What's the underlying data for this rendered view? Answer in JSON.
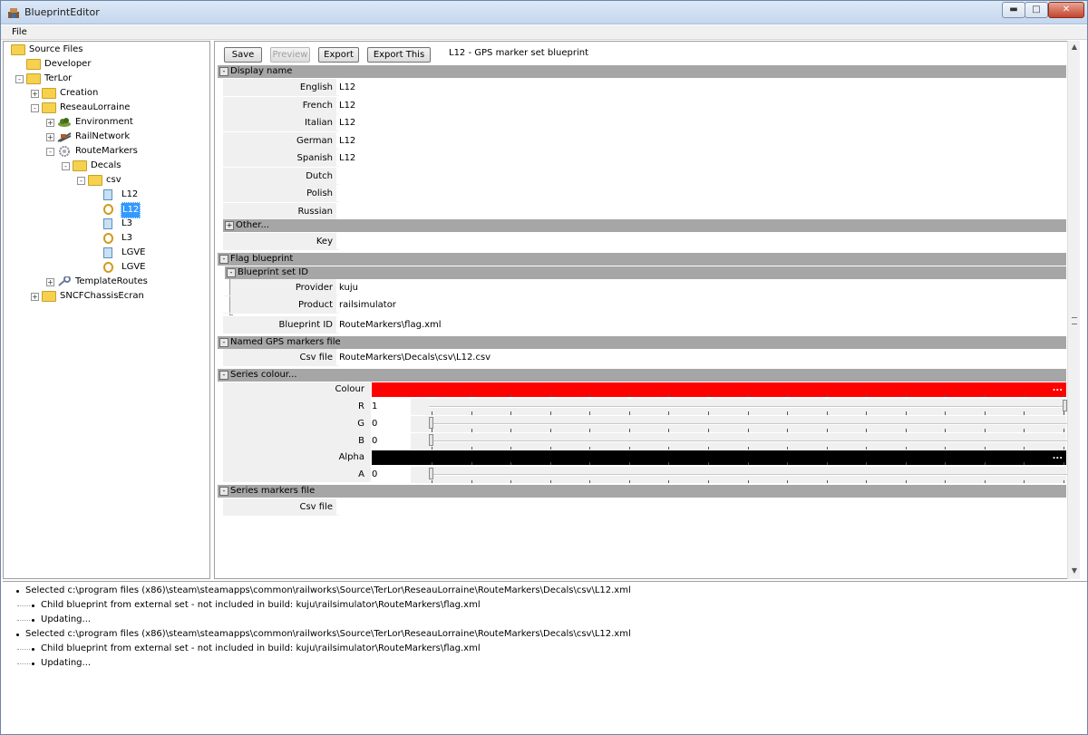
{
  "window": {
    "title": "BlueprintEditor",
    "min": "0",
    "max": "1",
    "close": "x"
  },
  "menu": {
    "file": "File"
  },
  "tree": [
    {
      "id": "source-files",
      "label": "Source Files",
      "icon": "folder-icon",
      "level": 0,
      "exp": ""
    },
    {
      "id": "developer",
      "label": "Developer",
      "icon": "folder-icon",
      "level": 1,
      "exp": ""
    },
    {
      "id": "terlor",
      "label": "TerLor",
      "icon": "folder-icon",
      "level": 1,
      "exp": "-"
    },
    {
      "id": "creation",
      "label": "Creation",
      "icon": "folder-icon",
      "level": 2,
      "exp": "+"
    },
    {
      "id": "reseaulorraine",
      "label": "ReseauLorraine",
      "icon": "folder-icon",
      "level": 2,
      "exp": "-"
    },
    {
      "id": "environment",
      "label": "Environment",
      "icon": "environment-icon",
      "level": 3,
      "exp": "+"
    },
    {
      "id": "railnetwork",
      "label": "RailNetwork",
      "icon": "rail-icon",
      "level": 3,
      "exp": "+"
    },
    {
      "id": "routemarkers",
      "label": "RouteMarkers",
      "icon": "gear-icon",
      "level": 3,
      "exp": "-"
    },
    {
      "id": "decals",
      "label": "Decals",
      "icon": "folder-icon",
      "level": 4,
      "exp": "-"
    },
    {
      "id": "csv",
      "label": "csv",
      "icon": "folder-icon",
      "level": 5,
      "exp": "-"
    },
    {
      "id": "l12-doc",
      "label": "L12",
      "icon": "document-icon",
      "level": 6,
      "exp": ""
    },
    {
      "id": "l12-gps",
      "label": "L12",
      "icon": "gps-marker-icon",
      "level": 6,
      "exp": "",
      "selected": true
    },
    {
      "id": "l3-doc",
      "label": "L3",
      "icon": "document-icon",
      "level": 6,
      "exp": ""
    },
    {
      "id": "l3-gps",
      "label": "L3",
      "icon": "gps-marker-icon",
      "level": 6,
      "exp": ""
    },
    {
      "id": "lgve-doc",
      "label": "LGVE",
      "icon": "document-icon",
      "level": 6,
      "exp": ""
    },
    {
      "id": "lgve-gps",
      "label": "LGVE",
      "icon": "gps-marker-icon",
      "level": 6,
      "exp": ""
    },
    {
      "id": "templateroutes",
      "label": "TemplateRoutes",
      "icon": "wrench-icon",
      "level": 3,
      "exp": "+"
    },
    {
      "id": "sncfchassisecran",
      "label": "SNCFChassisEcran",
      "icon": "folder-icon",
      "level": 2,
      "exp": "+"
    }
  ],
  "toolbar": {
    "save": "Save",
    "preview": "Preview",
    "export": "Export",
    "export_this": "Export This",
    "title": "L12 - GPS marker set blueprint"
  },
  "display_name": {
    "header": "Display name",
    "toggle": "-",
    "rows": [
      {
        "label": "English",
        "value": "L12"
      },
      {
        "label": "French",
        "value": "L12"
      },
      {
        "label": "Italian",
        "value": "L12"
      },
      {
        "label": "German",
        "value": "L12"
      },
      {
        "label": "Spanish",
        "value": "L12"
      },
      {
        "label": "Dutch",
        "value": ""
      },
      {
        "label": "Polish",
        "value": ""
      },
      {
        "label": "Russian",
        "value": ""
      }
    ],
    "other": "Other...",
    "other_toggle": "+",
    "key_label": "Key",
    "key_value": ""
  },
  "flag_blueprint": {
    "header": "Flag blueprint",
    "toggle": "-",
    "set_id_header": "Blueprint set ID",
    "set_id_toggle": "-",
    "provider_label": "Provider",
    "provider_value": "kuju",
    "product_label": "Product",
    "product_value": "railsimulator",
    "blueprint_id_label": "Blueprint ID",
    "blueprint_id_value": "RouteMarkers\\flag.xml"
  },
  "named_gps": {
    "header": "Named GPS markers file",
    "toggle": "-",
    "csv_label": "Csv file",
    "csv_value": "RouteMarkers\\Decals\\csv\\L12.csv"
  },
  "series_colour": {
    "header": "Series colour...",
    "toggle": "-",
    "colour_label": "Colour",
    "colour_hex": "#ff0000",
    "colour_btn": "...",
    "r_label": "R",
    "r_value": "1",
    "r_level": 1.0,
    "g_label": "G",
    "g_value": "0",
    "g_level": 0.0,
    "b_label": "B",
    "b_value": "0",
    "b_level": 0.0,
    "alpha_label": "Alpha",
    "alpha_hex": "#000000",
    "alpha_btn": "...",
    "a_label": "A",
    "a_value": "0",
    "a_level": 0.0
  },
  "series_markers": {
    "header": "Series markers file",
    "toggle": "-",
    "csv_label": "Csv file",
    "csv_value": ""
  },
  "log": [
    {
      "text": "Selected c:\\program files (x86)\\steam\\steamapps\\common\\railworks\\Source\\TerLor\\ReseauLorraine\\RouteMarkers\\Decals\\csv\\L12.xml",
      "level": 0
    },
    {
      "text": "Child blueprint from external set - not included in build: kuju\\railsimulator\\RouteMarkers\\flag.xml",
      "level": 1
    },
    {
      "text": "Updating...",
      "level": 1
    },
    {
      "text": "Selected c:\\program files (x86)\\steam\\steamapps\\common\\railworks\\Source\\TerLor\\ReseauLorraine\\RouteMarkers\\Decals\\csv\\L12.xml",
      "level": 0
    },
    {
      "text": "Child blueprint from external set - not included in build: kuju\\railsimulator\\RouteMarkers\\flag.xml",
      "level": 1
    },
    {
      "text": "Updating...",
      "level": 1
    }
  ]
}
